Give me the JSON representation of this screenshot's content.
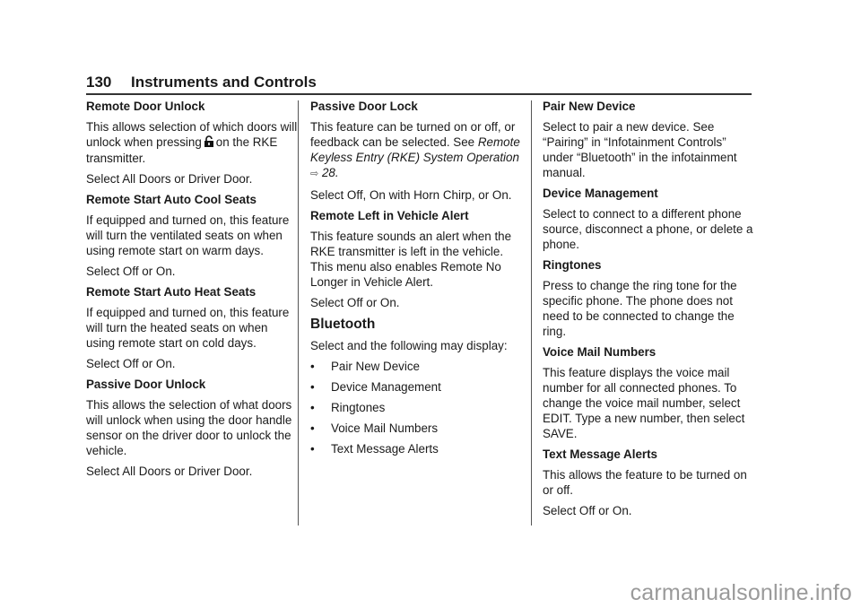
{
  "header": {
    "page_number": "130",
    "title": "Instruments and Controls"
  },
  "column1": {
    "remote_door_unlock": {
      "heading": "Remote Door Unlock",
      "text_before_icon": "This allows selection of which doors will unlock when pressing",
      "icon": "unlock-icon",
      "text_after_icon": "on the RKE transmitter.",
      "select": "Select All Doors or Driver Door."
    },
    "auto_cool_seats": {
      "heading": "Remote Start Auto Cool Seats",
      "text": "If equipped and turned on, this feature will turn the ventilated seats on when using remote start on warm days.",
      "select": "Select Off or On."
    },
    "auto_heat_seats": {
      "heading": "Remote Start Auto Heat Seats",
      "text": "If equipped and turned on, this feature will turn the heated seats on when using remote start on cold days.",
      "select": "Select Off or On."
    },
    "passive_door_unlock": {
      "heading": "Passive Door Unlock",
      "text": "This allows the selection of what doors will unlock when using the door handle sensor on the driver door to unlock the vehicle.",
      "select": "Select All Doors or Driver Door."
    }
  },
  "column2": {
    "passive_door_lock": {
      "heading": "Passive Door Lock",
      "text": "This feature can be turned on or off, or feedback can be selected. See",
      "xref": "Remote Keyless Entry (RKE) System Operation",
      "xref_icon": "page-reference-arrow-icon",
      "xref_page": "28",
      "select": "Select Off, On with Horn Chirp, or On."
    },
    "remote_left_alert": {
      "heading": "Remote Left in Vehicle Alert",
      "text": "This feature sounds an alert when the RKE transmitter is left in the vehicle. This menu also enables Remote No Longer in Vehicle Alert.",
      "select": "Select Off or On."
    },
    "bluetooth": {
      "heading": "Bluetooth",
      "intro": "Select and the following may display:",
      "bullet": "•",
      "items": [
        "Pair New Device",
        "Device Management",
        "Ringtones",
        "Voice Mail Numbers",
        "Text Message Alerts"
      ]
    }
  },
  "column3": {
    "pair_new_device": {
      "heading": "Pair New Device",
      "text": "Select to pair a new device. See “Pairing” in “Infotainment Controls” under “Bluetooth” in the infotainment manual."
    },
    "device_management": {
      "heading": "Device Management",
      "text": "Select to connect to a different phone source, disconnect a phone, or delete a phone."
    },
    "ringtones": {
      "heading": "Ringtones",
      "text": "Press to change the ring tone for the specific phone. The phone does not need to be connected to change the ring."
    },
    "voice_mail_numbers": {
      "heading": "Voice Mail Numbers",
      "text": "This feature displays the voice mail number for all connected phones. To change the voice mail number, select EDIT. Type a new number, then select SAVE."
    },
    "text_message_alerts": {
      "heading": "Text Message Alerts",
      "text": "This allows the feature to be turned on or off.",
      "select": "Select Off or On."
    }
  },
  "watermark": "carmanualsonline.info"
}
